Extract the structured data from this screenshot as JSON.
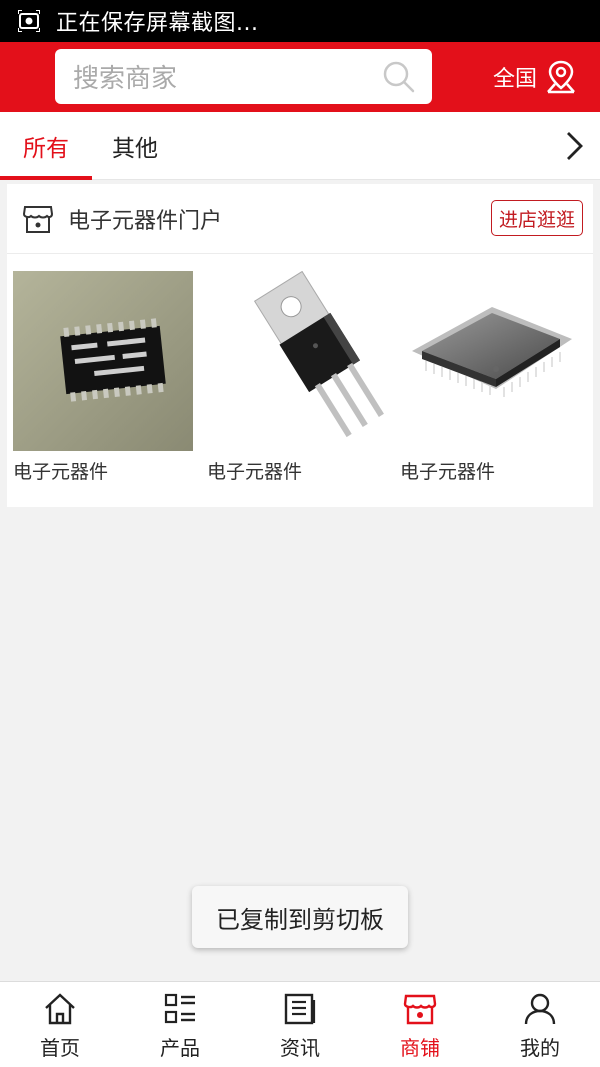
{
  "status_bar": {
    "text": "正在保存屏幕截图..."
  },
  "header": {
    "search_placeholder": "搜索商家",
    "region_label": "全国"
  },
  "tabs": [
    {
      "label": "所有",
      "active": true
    },
    {
      "label": "其他",
      "active": false
    }
  ],
  "shop": {
    "name": "电子元器件门户",
    "visit_label": "进店逛逛",
    "products": [
      {
        "name": "电子元器件",
        "image": "soic-chip"
      },
      {
        "name": "电子元器件",
        "image": "to220-transistor"
      },
      {
        "name": "电子元器件",
        "image": "qfp-chip"
      }
    ]
  },
  "toast": {
    "text": "已复制到剪切板"
  },
  "bottom_nav": [
    {
      "label": "首页",
      "icon": "home-icon",
      "active": false
    },
    {
      "label": "产品",
      "icon": "grid-list-icon",
      "active": false
    },
    {
      "label": "资讯",
      "icon": "news-icon",
      "active": false
    },
    {
      "label": "商铺",
      "icon": "store-icon",
      "active": true
    },
    {
      "label": "我的",
      "icon": "user-icon",
      "active": false
    }
  ],
  "colors": {
    "brand_red": "#e3101a",
    "badge_red": "#c21b21"
  }
}
